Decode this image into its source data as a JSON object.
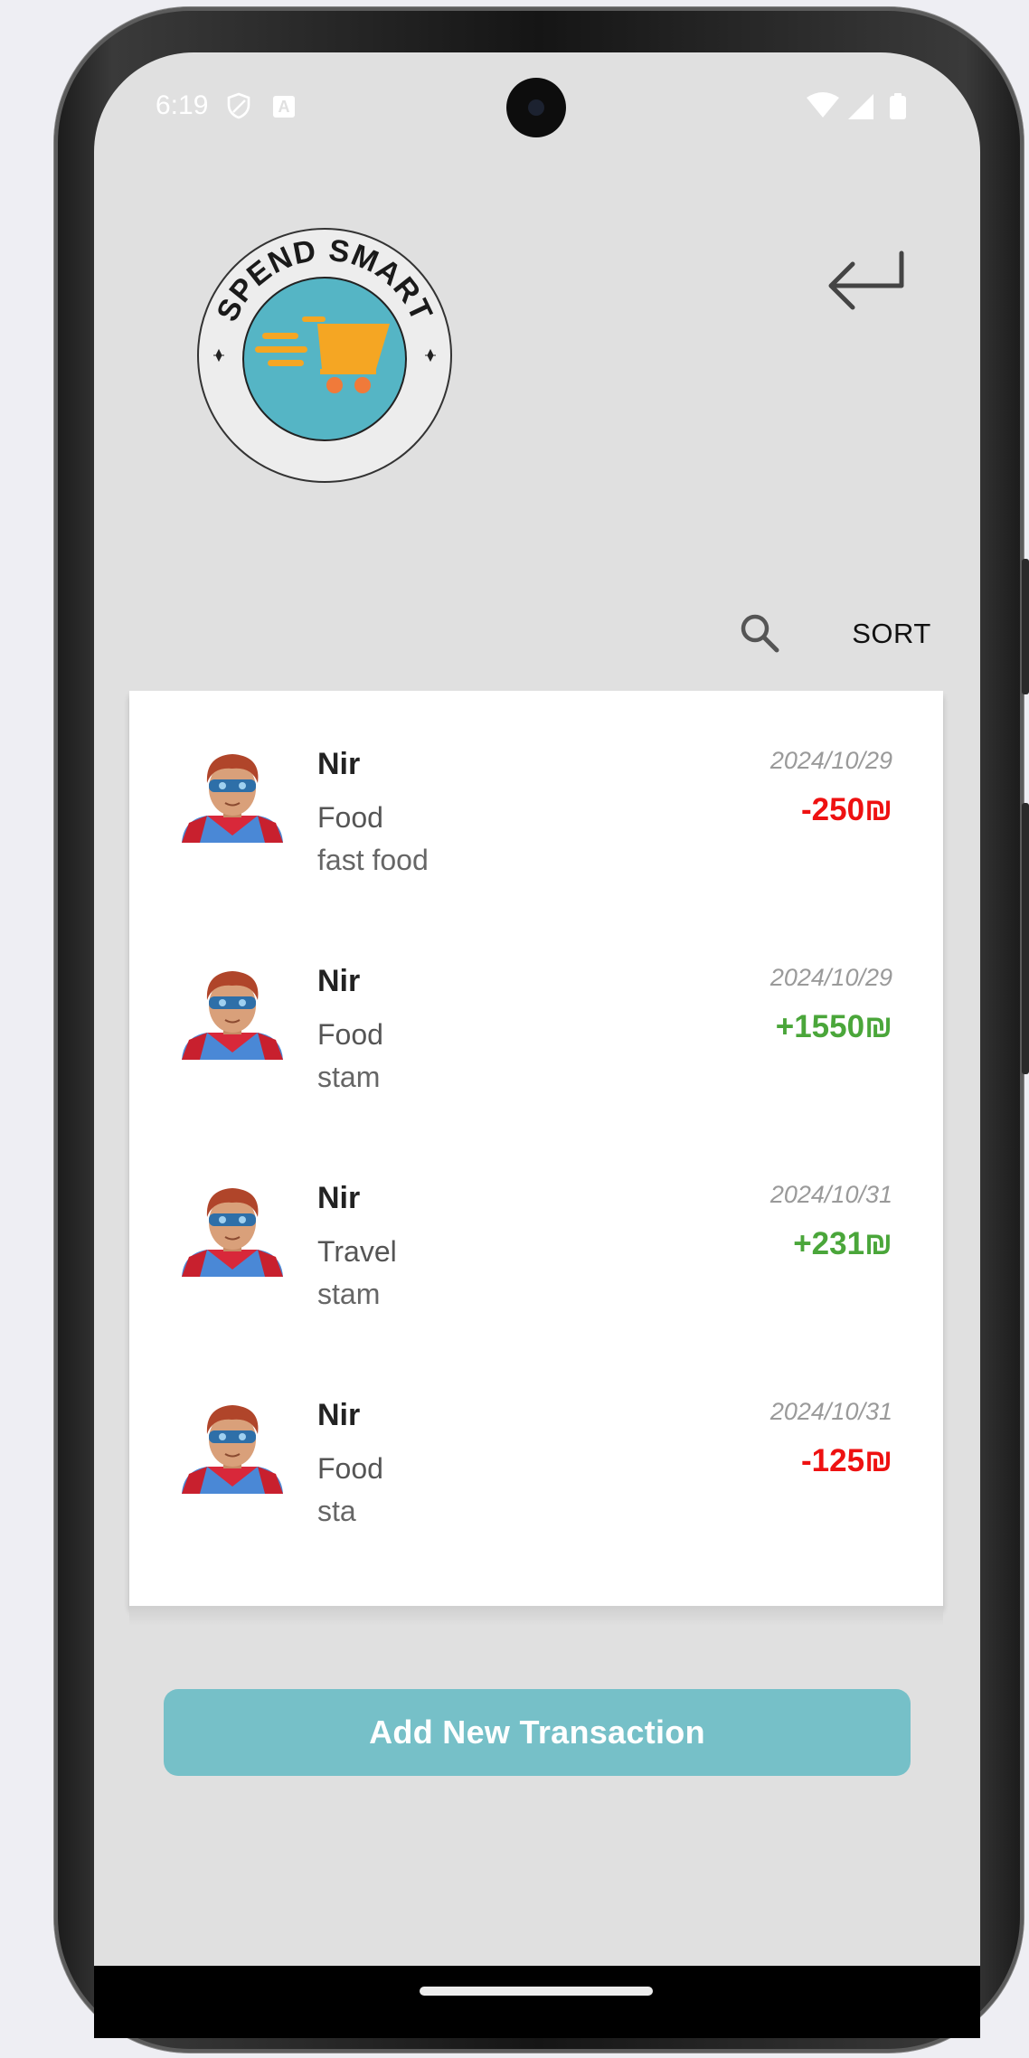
{
  "status_bar": {
    "time": "6:19",
    "notification_badge": "A"
  },
  "logo": {
    "text": "SPEND SMART",
    "colors": {
      "ring": "#ededed",
      "inner": "#55b5c5",
      "cart": "#f5a623",
      "wheels": "#f07a3a"
    }
  },
  "toolbar": {
    "sort_label": "SORT",
    "search_icon": "search-icon",
    "back_icon": "return-arrow-icon"
  },
  "transactions": [
    {
      "name": "Nir",
      "category": "Food",
      "note": "fast food",
      "date": "2024/10/29",
      "amount": "-250₪",
      "type": "expense"
    },
    {
      "name": "Nir",
      "category": "Food",
      "note": "stam",
      "date": "2024/10/29",
      "amount": "+1550₪",
      "type": "income"
    },
    {
      "name": "Nir",
      "category": "Travel",
      "note": "stam",
      "date": "2024/10/31",
      "amount": "+231₪",
      "type": "income"
    },
    {
      "name": "Nir",
      "category": "Food",
      "note": "sta",
      "date": "2024/10/31",
      "amount": "-125₪",
      "type": "expense"
    }
  ],
  "add_button": {
    "label": "Add New Transaction"
  },
  "colors": {
    "expense": "#ee1111",
    "income": "#4aa63a",
    "accent": "#76c0c8",
    "background": "#e0e0e0"
  }
}
